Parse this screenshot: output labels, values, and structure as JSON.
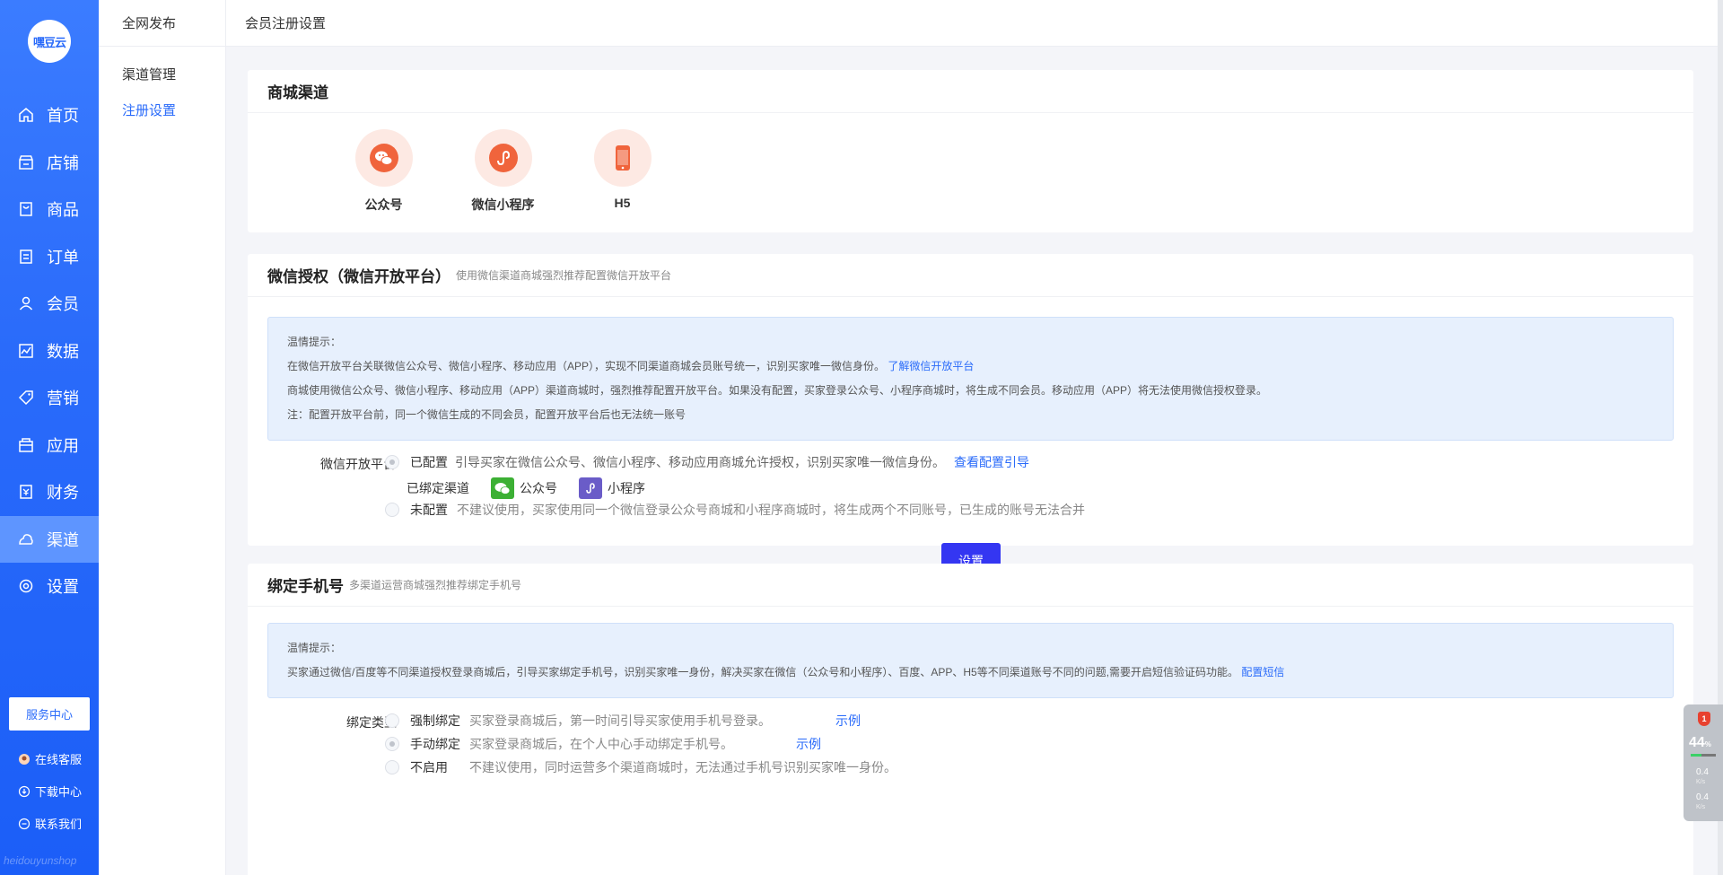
{
  "logo": "嘿豆云",
  "nav": [
    {
      "label": "首页",
      "icon": "home-icon"
    },
    {
      "label": "店铺",
      "icon": "store-icon"
    },
    {
      "label": "商品",
      "icon": "goods-icon"
    },
    {
      "label": "订单",
      "icon": "order-icon"
    },
    {
      "label": "会员",
      "icon": "member-icon"
    },
    {
      "label": "数据",
      "icon": "chart-icon"
    },
    {
      "label": "营销",
      "icon": "tag-icon"
    },
    {
      "label": "应用",
      "icon": "app-icon"
    },
    {
      "label": "财务",
      "icon": "finance-icon"
    },
    {
      "label": "渠道",
      "icon": "channel-icon",
      "active": true
    },
    {
      "label": "设置",
      "icon": "gear-icon"
    }
  ],
  "sidebar_footer": {
    "service": "服务中心",
    "online": "在线客服",
    "download": "下载中心",
    "contact": "联系我们",
    "watermark": "heidouyunshop"
  },
  "subside": {
    "head": "全网发布",
    "items": [
      "渠道管理",
      "注册设置"
    ]
  },
  "topbar": {
    "title": "会员注册设置"
  },
  "mall_channel": {
    "title": "商城渠道",
    "channels": [
      "公众号",
      "微信小程序",
      "H5"
    ]
  },
  "wechat_auth": {
    "title": "微信授权（微信开放平台）",
    "subtitle": "使用微信渠道商城强烈推荐配置微信开放平台",
    "tip_title": "温情提示：",
    "tip_line1": "在微信开放平台关联微信公众号、微信小程序、移动应用（APP），实现不同渠道商城会员账号统一，识别买家唯一微信身份。",
    "tip_link1": "了解微信开放平台",
    "tip_line2": "商城使用微信公众号、微信小程序、移动应用（APP）渠道商城时，强烈推荐配置开放平台。如果没有配置，买家登录公众号、小程序商城时，将生成不同会员。移动应用（APP）将无法使用微信授权登录。",
    "tip_line3": "注：配置开放平台前，同一个微信生成的不同会员，配置开放平台后也无法统一账号",
    "label": "微信开放平台",
    "opt1": "已配置",
    "opt1_desc": "引导买家在微信公众号、微信小程序、移动应用商城允许授权，识别买家唯一微信身份。",
    "opt1_link": "查看配置引导",
    "bound_label": "已绑定渠道",
    "bound1": "公众号",
    "bound2": "小程序",
    "opt2": "未配置",
    "opt2_desc": "不建议使用，买家使用同一个微信登录公众号商城和小程序商城时，将生成两个不同账号，已生成的账号无法合并",
    "button": "设置"
  },
  "bind_phone": {
    "title": "绑定手机号",
    "subtitle": "多渠道运营商城强烈推荐绑定手机号",
    "tip_title": "温情提示：",
    "tip_line1": "买家通过微信/百度等不同渠道授权登录商城后，引导买家绑定手机号，识别买家唯一身份，解决买家在微信（公众号和小程序）、百度、APP、H5等不同渠道账号不同的问题,需要开启短信验证码功能。",
    "tip_link1": "配置短信",
    "label": "绑定类型",
    "opt1": "强制绑定",
    "opt1_desc": "买家登录商城后，第一时间引导买家使用手机号登录。",
    "opt1_link": "示例",
    "opt2": "手动绑定",
    "opt2_desc": "买家登录商城后，在个人中心手动绑定手机号。",
    "opt2_link": "示例",
    "opt3": "不启用",
    "opt3_desc": "不建议使用，同时运营多个渠道商城时，无法通过手机号识别买家唯一身份。"
  },
  "monitor": {
    "badge": "1",
    "percent": "44",
    "percent_unit": "%",
    "up": "0.4",
    "up_unit": "K/s",
    "down": "0.4",
    "down_unit": "K/s",
    "fill": 0.44
  }
}
